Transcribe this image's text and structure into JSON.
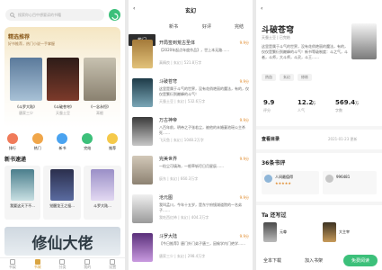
{
  "screen1": {
    "search_placeholder": "搜索你心目中想要读的书籍",
    "rec_title": "精选推荐",
    "rec_subtitle": "好书推荐，热门小说一手掌握",
    "rec_books": [
      {
        "title": "《斗罗大陆》",
        "author": "唐家三少"
      },
      {
        "title": "《斗破苍穹》",
        "author": "天蚕土豆"
      },
      {
        "title": "《一念永恒》",
        "author": "耳根"
      }
    ],
    "menu": [
      "排行",
      "热门",
      "新书",
      "完结",
      "推荐"
    ],
    "section_title": "新书速递",
    "new_books": [
      "我要这天下不...",
      "觉醒龙王之祖...",
      "斗罗大陆..."
    ],
    "banner_text": "修仙大佬",
    "tabs": [
      "书架",
      "书城",
      "分类",
      "我的",
      "设置"
    ]
  },
  "screen2": {
    "back": "‹",
    "title": "玄幻",
    "top_tabs": [
      "新书",
      "好评",
      "完结"
    ],
    "side": [
      "热门",
      "新书",
      "好评"
    ],
    "items": [
      {
        "title": "开局签到荒古圣体",
        "score": "9.9分",
        "desc": "【2020年起点年度作品】，世上本无路……",
        "meta": "真精良 | 玄幻 | 521.8万字"
      },
      {
        "title": "斗破苍穹",
        "score": "9.9分",
        "desc": "这里是属于斗气的世界，没有花俏艳丽的魔法，有的，仅仅是繁衍到巅峰的斗气！",
        "meta": "天蚕土豆 | 玄幻 | 532.6万字"
      },
      {
        "title": "万古神帝",
        "score": "9.9分",
        "desc": "八百年前，明帝之子张若尘，被他的未婚妻池瑶公主杀死……",
        "meta": "飞天鱼 | 玄幻 | 1048.2万字"
      },
      {
        "title": "完美世界",
        "score": "9.9分",
        "desc": "一粒尘可填海，一根草斩尽日月星辰……",
        "meta": "辰东 | 玄幻 | 660.3万字"
      },
      {
        "title": "沧元图",
        "score": "9.9分",
        "desc": "我叫孟川，今年十五岁，是东宁府镜湖道院的一名弟子……",
        "meta": "我吃西红柿 | 玄幻 | 404.3万字"
      },
      {
        "title": "斗罗大陆",
        "score": "9.9分",
        "desc": "【今日推荐】唐门外门弟子唐三，因偷学内门绝学……",
        "meta": "唐家三少 | 玄幻 | 298.4万字"
      }
    ]
  },
  "screen3": {
    "back": "‹",
    "title": "斗破苍穹",
    "author": "天蚕土豆 | 已完结",
    "desc": "这里是属于斗气的世界，没有花俏艳丽的魔法，有的，仅仅是繁衍到巅峰的斗气！新书等级制度：斗之气，斗者，斗师，大斗师，斗灵，斗王……",
    "tags": [
      "热血",
      "玄幻",
      "修炼"
    ],
    "stats": [
      {
        "value": "9.9",
        "label": "评分"
      },
      {
        "value": "12.2",
        "unit": "万",
        "label": "人气"
      },
      {
        "value": "569.4",
        "unit": "万",
        "label": "字数"
      }
    ],
    "catalog_label": "查看目录",
    "catalog_date": "2021-01-23 更新",
    "comments_title": "36条书评",
    "comment_users": [
      "人间最值得",
      "996481"
    ],
    "also_title": "Ta 还写过",
    "also_books": [
      "元尊",
      "大主宰"
    ],
    "buttons": {
      "download": "全本下载",
      "shelf": "加入书架",
      "read": "免费阅读"
    }
  }
}
